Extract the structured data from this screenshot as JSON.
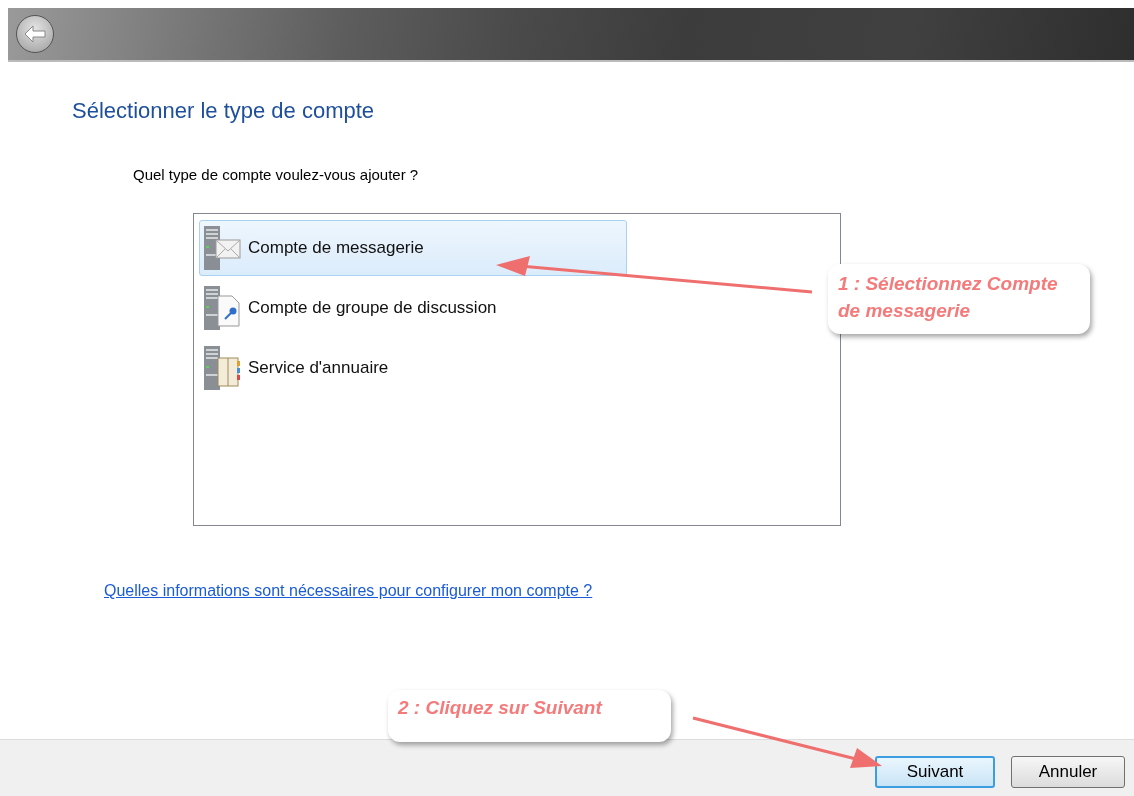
{
  "heading": "Sélectionner le type de compte",
  "prompt": "Quel type de compte voulez-vous ajouter ?",
  "account_types": [
    {
      "label": "Compte de messagerie",
      "selected": true,
      "kind": "mail"
    },
    {
      "label": "Compte de groupe de discussion",
      "selected": false,
      "kind": "newsgroup"
    },
    {
      "label": "Service d'annuaire",
      "selected": false,
      "kind": "directory"
    }
  ],
  "help_link": "Quelles informations sont nécessaires pour configurer mon compte ?",
  "buttons": [
    {
      "label": "Suivant",
      "default": true
    },
    {
      "label": "Annuler",
      "default": false
    }
  ],
  "annotations": [
    {
      "text": "1 : Sélectionnez Compte de messagerie"
    },
    {
      "text": "2 : Cliquez sur Suivant"
    }
  ]
}
